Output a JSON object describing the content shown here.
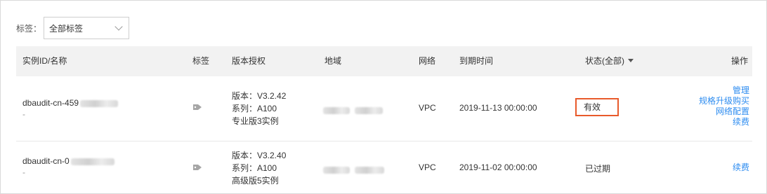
{
  "filter": {
    "label": "标签：",
    "select_value": "全部标签"
  },
  "table": {
    "headers": {
      "instance": "实例ID/名称",
      "tag": "标签",
      "license": "版本授权",
      "region": "地域",
      "network": "网络",
      "expiry": "到期时间",
      "status": "状态(全部)",
      "actions": "操作"
    },
    "rows": [
      {
        "name": "dbaudit-cn-459",
        "sub": "-",
        "version": "版本：V3.2.42",
        "series": "系列：A100",
        "edition": "专业版3实例",
        "network": "VPC",
        "expiry": "2019-11-13 00:00:00",
        "status": "有效",
        "actions": [
          "管理",
          "规格升级购买",
          "网络配置",
          "续费"
        ]
      },
      {
        "name": "dbaudit-cn-0",
        "sub": "-",
        "version": "版本：V3.2.40",
        "series": "系列：A100",
        "edition": "高级版5实例",
        "network": "VPC",
        "expiry": "2019-11-02 00:00:00",
        "status": "已过期",
        "actions": [
          "续费"
        ]
      }
    ]
  },
  "colors": {
    "link": "#2d8cf0",
    "highlight_border": "#e85a2b",
    "header_bg": "#f2f2f2"
  },
  "icons": {
    "select": "chevron-down-icon",
    "tag": "tag-icon",
    "sort": "caret-down-icon"
  }
}
